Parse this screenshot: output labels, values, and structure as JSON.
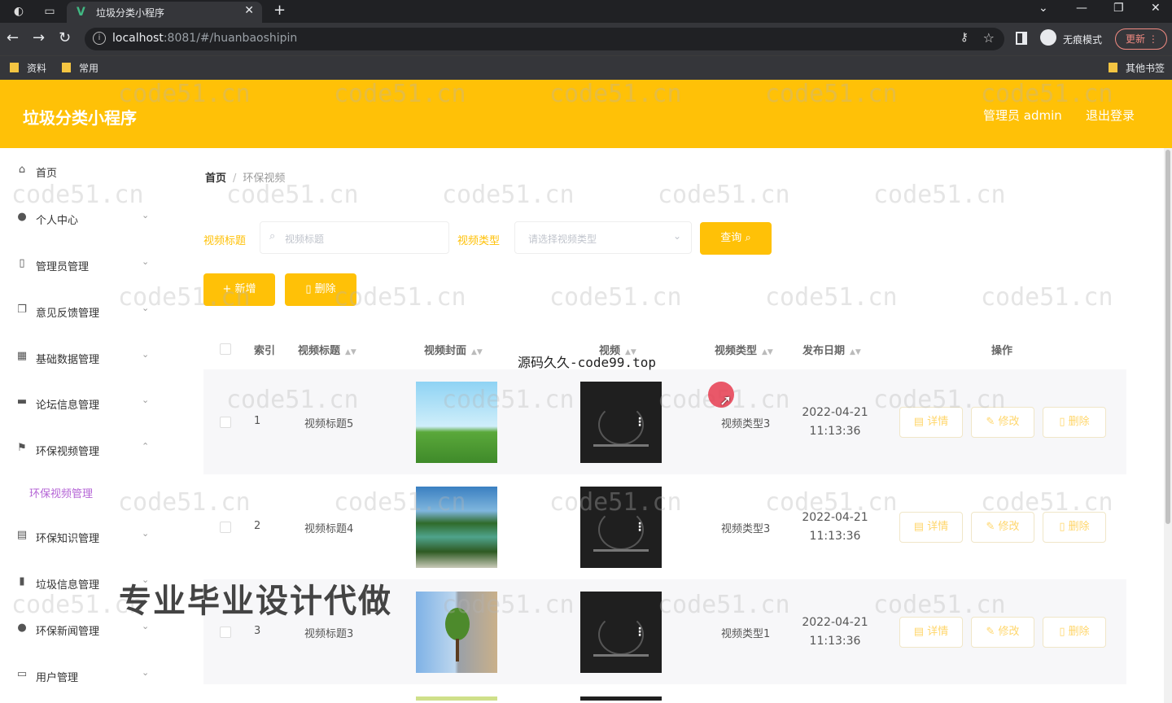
{
  "browser": {
    "tab_title": "垃圾分类小程序",
    "url_host": "localhost",
    "url_rest": ":8081/#/huanbaoshipin",
    "incognito_label": "无痕模式",
    "update_label": "更新",
    "bookmarks": [
      "资料",
      "常用"
    ],
    "other_bookmarks": "其他书签"
  },
  "header": {
    "app_title": "垃圾分类小程序",
    "user_label": "管理员 admin",
    "logout_label": "退出登录",
    "color": "#ffc107"
  },
  "sidebar": {
    "items": [
      {
        "label": "首页",
        "icon": "home-icon",
        "has_arrow": false
      },
      {
        "label": "个人中心",
        "icon": "user-icon",
        "has_arrow": true
      },
      {
        "label": "管理员管理",
        "icon": "phone-icon",
        "has_arrow": true
      },
      {
        "label": "意见反馈管理",
        "icon": "copy-icon",
        "has_arrow": true
      },
      {
        "label": "基础数据管理",
        "icon": "grid-icon",
        "has_arrow": true
      },
      {
        "label": "论坛信息管理",
        "icon": "monitor-icon",
        "has_arrow": true
      },
      {
        "label": "环保视频管理",
        "icon": "flag-icon",
        "has_arrow": true,
        "expanded": true
      },
      {
        "label": "环保知识管理",
        "icon": "doc-icon",
        "has_arrow": true
      },
      {
        "label": "垃圾信息管理",
        "icon": "bar-chart-icon",
        "has_arrow": true
      },
      {
        "label": "环保新闻管理",
        "icon": "bulb-icon",
        "has_arrow": true
      },
      {
        "label": "用户管理",
        "icon": "keyboard-icon",
        "has_arrow": true
      }
    ],
    "active_sub": "环保视频管理"
  },
  "breadcrumb": {
    "home": "首页",
    "current": "环保视频"
  },
  "filters": {
    "title_label": "视频标题",
    "title_placeholder": "视频标题",
    "type_label": "视频类型",
    "type_placeholder": "请选择视频类型",
    "query_label": "查询"
  },
  "actions": {
    "add_label": "新增",
    "delete_label": "删除"
  },
  "table": {
    "headers": [
      "索引",
      "视频标题",
      "视频封面",
      "视频",
      "视频类型",
      "发布日期",
      "操作"
    ],
    "rows": [
      {
        "index": "1",
        "title": "视频标题5",
        "type": "视频类型3",
        "date": "2022-04-21",
        "time": "11:13:36",
        "cover": "sky-field"
      },
      {
        "index": "2",
        "title": "视频标题4",
        "type": "视频类型3",
        "date": "2022-04-21",
        "time": "11:13:36",
        "cover": "lake-valley"
      },
      {
        "index": "3",
        "title": "视频标题3",
        "type": "视频类型1",
        "date": "2022-04-21",
        "time": "11:13:36",
        "cover": "tree-split"
      }
    ],
    "row_actions": {
      "detail": "详情",
      "edit": "修改",
      "delete": "删除"
    }
  },
  "overlays": {
    "source_text": "源码久久-code99.top",
    "promo_text": "专业毕业设计代做",
    "watermark": "code51.cn"
  }
}
